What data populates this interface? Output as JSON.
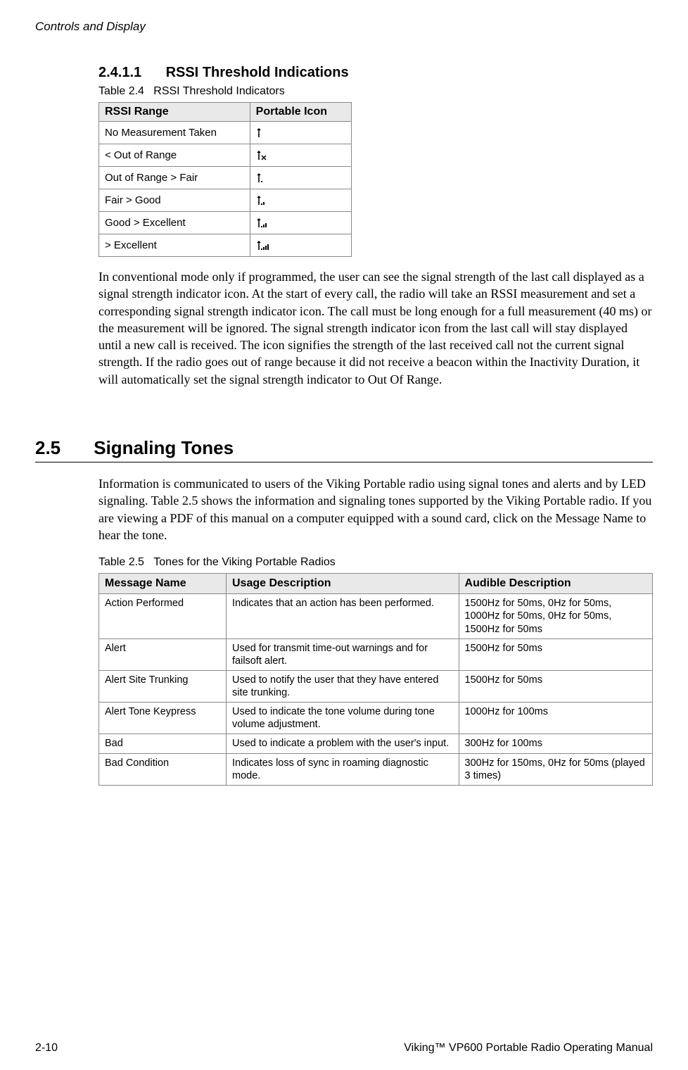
{
  "header": {
    "section_title": "Controls and Display"
  },
  "subsection": {
    "number": "2.4.1.1",
    "title": "RSSI Threshold Indications",
    "table_caption_label": "Table 2.4",
    "table_caption_text": "RSSI Threshold Indicators",
    "table_headers": {
      "col1": "RSSI Range",
      "col2": "Portable Icon"
    },
    "rows": [
      {
        "range": "No Measurement Taken",
        "icon": "none"
      },
      {
        "range": "< Out of Range",
        "icon": "x"
      },
      {
        "range": "Out of Range > Fair",
        "icon": "b1"
      },
      {
        "range": "Fair > Good",
        "icon": "b2"
      },
      {
        "range": "Good > Excellent",
        "icon": "b3"
      },
      {
        "range": "> Excellent",
        "icon": "b4"
      }
    ],
    "paragraph": "In conventional mode only if programmed, the user can see the signal strength of the last call displayed as a signal strength indicator icon. At the start of every call, the radio will take an RSSI measurement and set a corresponding signal strength indicator icon. The call must be long enough for a full measurement (40 ms) or the measurement will be ignored. The signal strength indicator icon from the last call will stay displayed until a new call is received. The icon signifies the strength of the last received call not the current signal strength. If the radio goes out of range because it did not receive a beacon within the Inactivity Duration, it will automatically set the signal strength indicator to Out Of Range."
  },
  "section25": {
    "number": "2.5",
    "title": "Signaling Tones",
    "paragraph": "Information is communicated to users of the Viking Portable radio using signal tones and alerts and by LED signaling. Table 2.5 shows the information and signaling tones supported by the Viking Portable radio. If you are viewing a PDF of this manual on a computer equipped with a sound card, click on the Message Name to hear the tone.",
    "table_caption_label": "Table 2.5",
    "table_caption_text": "Tones for the Viking Portable Radios",
    "table_headers": {
      "col1": "Message Name",
      "col2": "Usage Description",
      "col3": "Audible Description"
    },
    "rows": [
      {
        "name": "Action Performed",
        "usage": "Indicates that an action has been performed.",
        "audible": "1500Hz for 50ms, 0Hz for 50ms, 1000Hz for 50ms, 0Hz for 50ms, 1500Hz for 50ms"
      },
      {
        "name": "Alert",
        "usage": "Used for transmit time-out warnings and for failsoft alert.",
        "audible": "1500Hz for 50ms"
      },
      {
        "name": "Alert Site Trunking",
        "usage": "Used to notify the user that they have entered site trunking.",
        "audible": "1500Hz for 50ms"
      },
      {
        "name": "Alert Tone Keypress",
        "usage": "Used to indicate the tone volume during tone volume adjustment.",
        "audible": "1000Hz for 100ms"
      },
      {
        "name": "Bad",
        "usage": "Used to indicate a problem with the user's input.",
        "audible": "300Hz for 100ms"
      },
      {
        "name": "Bad Condition",
        "usage": "Indicates loss of sync in roaming diagnostic mode.",
        "audible": "300Hz for 150ms, 0Hz for 50ms (played 3 times)"
      }
    ]
  },
  "footer": {
    "page_number": "2-10",
    "book_title": "Viking™ VP600 Portable Radio Operating Manual"
  }
}
